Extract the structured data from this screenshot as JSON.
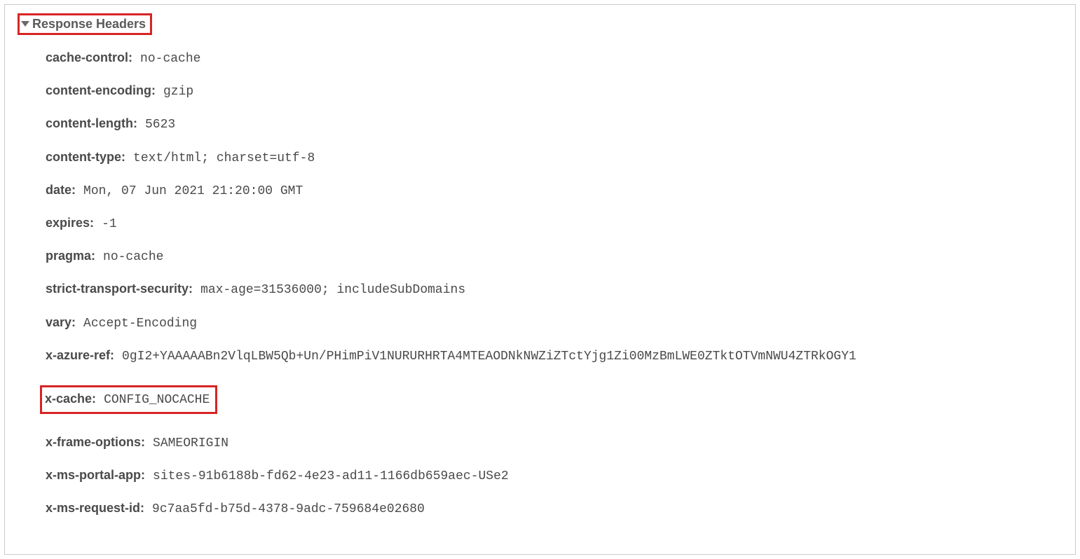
{
  "section": {
    "title": "Response Headers"
  },
  "headers": {
    "cacheControl": {
      "name": "cache-control:",
      "value": "no-cache"
    },
    "contentEncoding": {
      "name": "content-encoding:",
      "value": "gzip"
    },
    "contentLength": {
      "name": "content-length:",
      "value": "5623"
    },
    "contentType": {
      "name": "content-type:",
      "value": "text/html; charset=utf-8"
    },
    "date": {
      "name": "date:",
      "value": "Mon, 07 Jun 2021 21:20:00 GMT"
    },
    "expires": {
      "name": "expires:",
      "value": "-1"
    },
    "pragma": {
      "name": "pragma:",
      "value": "no-cache"
    },
    "sts": {
      "name": "strict-transport-security:",
      "value": "max-age=31536000; includeSubDomains"
    },
    "vary": {
      "name": "vary:",
      "value": "Accept-Encoding"
    },
    "xAzureRef": {
      "name": "x-azure-ref:",
      "value": "0gI2+YAAAAABn2VlqLBW5Qb+Un/PHimPiV1NURURHRTA4MTEAODNkNWZiZTctYjg1Zi00MzBmLWE0ZTktOTVmNWU4ZTRkOGY1"
    },
    "xCache": {
      "name": "x-cache:",
      "value": "CONFIG_NOCACHE"
    },
    "xFrameOptions": {
      "name": "x-frame-options:",
      "value": "SAMEORIGIN"
    },
    "xMsPortalApp": {
      "name": "x-ms-portal-app:",
      "value": "sites-91b6188b-fd62-4e23-ad11-1166db659aec-USe2"
    },
    "xMsRequestId": {
      "name": "x-ms-request-id:",
      "value": "9c7aa5fd-b75d-4378-9adc-759684e02680"
    }
  }
}
